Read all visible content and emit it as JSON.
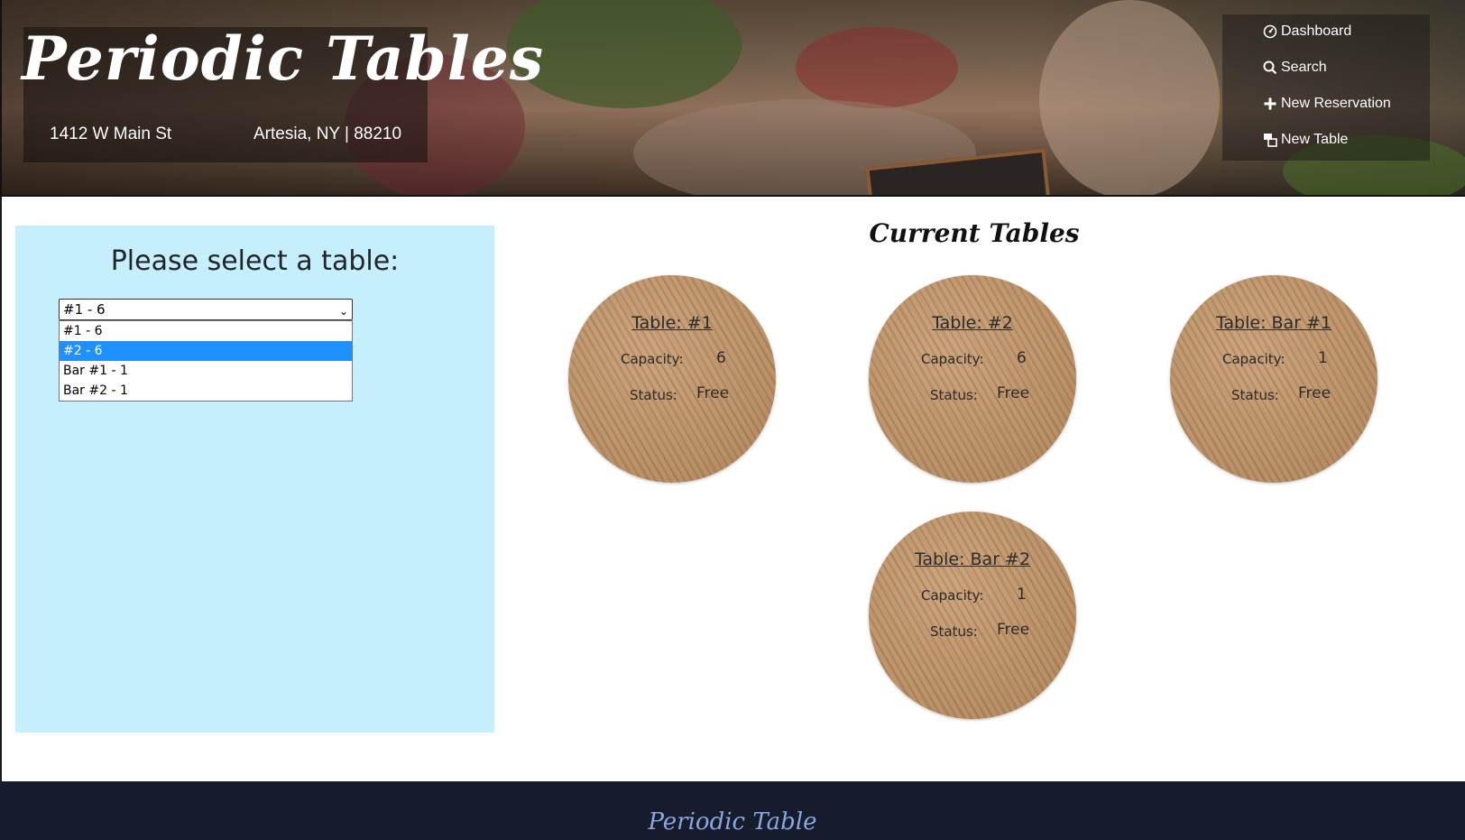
{
  "brand": {
    "title": "Periodic Tables",
    "address_line": "1412 W Main St",
    "city_line": "Artesia, NY | 88210"
  },
  "nav": {
    "items": [
      {
        "label": "Dashboard",
        "icon": "dashboard-icon"
      },
      {
        "label": "Search",
        "icon": "search-icon"
      },
      {
        "label": "New Reservation",
        "icon": "plus-icon"
      },
      {
        "label": "New Table",
        "icon": "new-table-icon"
      }
    ]
  },
  "seat": {
    "heading": "Please select a table:",
    "select_value": "#1 - 6",
    "options": [
      "#1 - 6",
      "#2 - 6",
      "Bar #1 - 1",
      "Bar #2 - 1"
    ],
    "highlighted_option": "#2 - 6"
  },
  "tables_section": {
    "title": "Current Tables",
    "capacity_label": "Capacity:",
    "status_label": "Status:",
    "tables": [
      {
        "name": "Table: #1",
        "capacity": "6",
        "status": "Free"
      },
      {
        "name": "Table: #2",
        "capacity": "6",
        "status": "Free"
      },
      {
        "name": "Table: Bar #1",
        "capacity": "1",
        "status": "Free"
      },
      {
        "name": "Table: Bar #2",
        "capacity": "1",
        "status": "Free"
      }
    ]
  },
  "footer": {
    "brand": "Periodic Table"
  },
  "colors": {
    "panel_bg": "#c5effc",
    "footer_bg": "#161c2c",
    "footer_text": "#8da5e0",
    "selected_option": "#1e90ff"
  }
}
